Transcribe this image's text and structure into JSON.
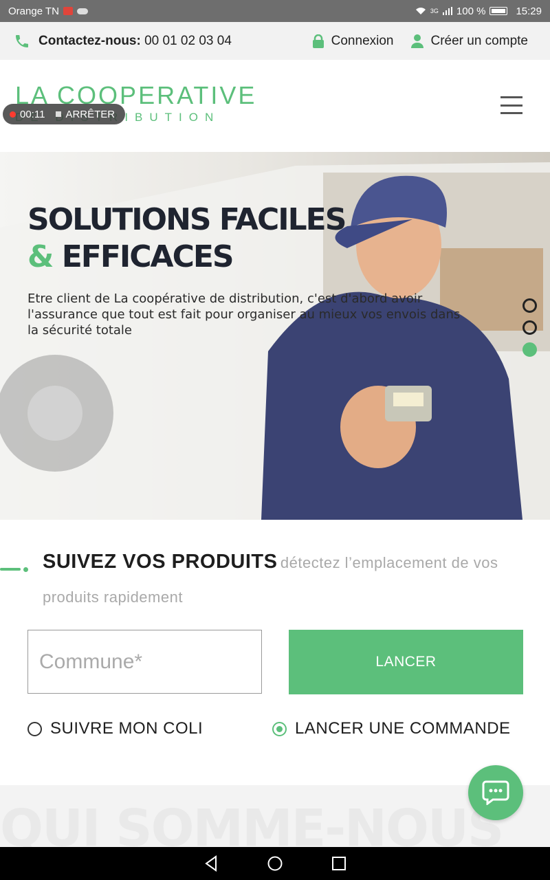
{
  "status_bar": {
    "carrier": "Orange TN",
    "network": "3G",
    "battery": "100 %",
    "time": "15:29"
  },
  "topbar": {
    "contact_label": "Contactez-nous:",
    "phone": "00 01 02 03 04",
    "login_label": "Connexion",
    "register_label": "Créer un compte"
  },
  "header": {
    "logo_top": "LA COOPERATIVE",
    "logo_bottom": "DE DISTRIBUTION",
    "recording": {
      "timer": "00:11",
      "stop_label": "ARRÊTER"
    }
  },
  "hero": {
    "title_line1": "SOLUTIONS FACILES",
    "title_amp": "&",
    "title_line2": "EFFICACES",
    "description": "Etre client de La coopérative de distribution, c'est d'abord avoir l'assurance que tout est fait pour organiser au mieux vos envois dans la sécurité totale",
    "slides_count": 3,
    "active_slide": 3
  },
  "tracking": {
    "heading_strong": "SUIVEZ VOS PRODUITS",
    "heading_light": "détectez l’emplacement de vos produits rapidement",
    "commune_placeholder": "Commune*",
    "commune_value": "",
    "launch_label": "LANCER",
    "options": [
      {
        "label": "SUIVRE MON COLI",
        "checked": false
      },
      {
        "label": "LANCER UNE COMMANDE",
        "checked": true
      }
    ]
  },
  "next_section": {
    "title": "QUI SOMME-NOUS"
  },
  "colors": {
    "brand_green": "#5cbf7b",
    "dark_text": "#1f2430",
    "topbar_bg": "#f2f2f2",
    "status_bar_bg": "#6e6e6e"
  },
  "icons": {
    "phone": "phone-icon",
    "lock": "lock-icon",
    "user": "user-icon",
    "menu": "hamburger-menu-icon",
    "chat": "chat-bubble-icon"
  }
}
